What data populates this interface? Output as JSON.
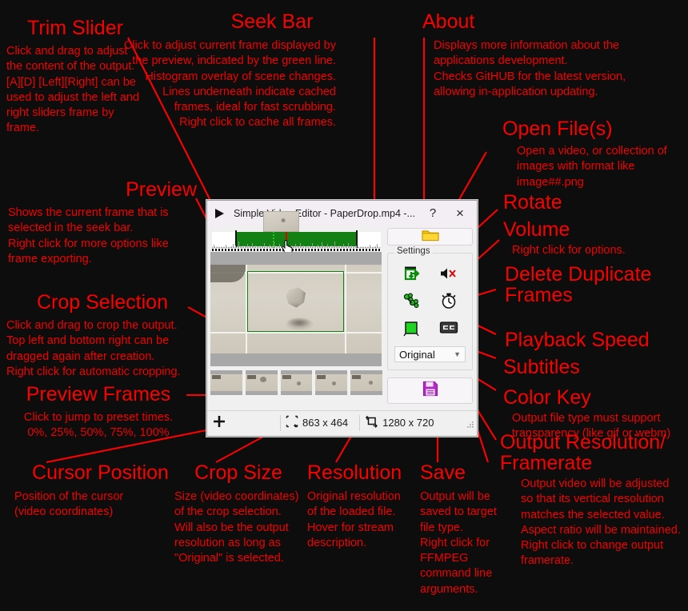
{
  "annotations": [
    {
      "key": "trim_slider",
      "title": "Trim Slider",
      "body": "Click and drag to adjust\nthe content of the output.\n[A][D] [Left][Right] can be\nused to adjust the left and\nright sliders frame by frame."
    },
    {
      "key": "seek_bar",
      "title": "Seek Bar",
      "body": "Click to adjust current frame displayed by\nthe preview, indicated by the green line.\nHistogram overlay of scene changes.\nLines underneath indicate cached\nframes, ideal for fast scrubbing.\nRight click to cache all frames."
    },
    {
      "key": "about",
      "title": "About",
      "body": "Displays more information about the\napplications development.\nChecks GitHUB for the latest version,\nallowing in-application updating."
    },
    {
      "key": "open_files",
      "title": "Open File(s)",
      "body": "Open a video, or collection of\nimages with format like\nimage##.png"
    },
    {
      "key": "rotate",
      "title": "Rotate",
      "body": ""
    },
    {
      "key": "volume",
      "title": "Volume",
      "body": "Right click for options."
    },
    {
      "key": "delete_duplicate_frames",
      "title": "Delete Duplicate Frames",
      "body": ""
    },
    {
      "key": "playback_speed",
      "title": "Playback Speed",
      "body": ""
    },
    {
      "key": "subtitles",
      "title": "Subtitles",
      "body": ""
    },
    {
      "key": "color_key",
      "title": "Color Key",
      "body": "Output file type must support\ntransparency (like gif or webm)"
    },
    {
      "key": "output_resolution",
      "title": "Output Resolution/ Framerate",
      "body": "Output video will be adjusted\nso that its vertical resolution\nmatches the selected value.\nAspect ratio will be maintained.\nRight click to change output\nframerate."
    },
    {
      "key": "preview",
      "title": "Preview",
      "body": "Shows the current frame that is\nselected in the seek bar.\nRight click for more options like\nframe exporting."
    },
    {
      "key": "crop_selection",
      "title": "Crop Selection",
      "body": "Click and drag to crop the output.\nTop left and bottom right can be\ndragged again after creation.\nRight click for automatic cropping."
    },
    {
      "key": "preview_frames",
      "title": "Preview Frames",
      "body": "Click to jump to preset times.\n0%, 25%, 50%, 75%, 100%"
    },
    {
      "key": "cursor_position",
      "title": "Cursor Position",
      "body": "Position of the cursor\n(video coordinates)"
    },
    {
      "key": "crop_size",
      "title": "Crop Size",
      "body": "Size (video coordinates)\nof the crop selection.\nWill also be the output\nresolution as long as\n\"Original\" is selected."
    },
    {
      "key": "resolution",
      "title": "Resolution",
      "body": "Original resolution\nof the loaded file.\nHover for stream\ndescription."
    },
    {
      "key": "save",
      "title": "Save",
      "body": "Output will be\nsaved to target\nfile type.\nRight click for\nFFMPEG\ncommand line\narguments."
    }
  ],
  "annotation_color": "#ff0000",
  "app": {
    "title": "Simple Video Editor - PaperDrop.mp4 -...",
    "icon": "play-triangle-icon",
    "titlebar_buttons": [
      {
        "name": "about",
        "label": "?"
      },
      {
        "name": "close",
        "label": "×"
      }
    ],
    "open_button": {
      "icon": "folder-icon",
      "label": ""
    },
    "settings": {
      "group_label": "Settings",
      "buttons": [
        {
          "name": "rotate",
          "icon": "rotate-icon"
        },
        {
          "name": "volume",
          "icon": "speaker-muted-icon"
        },
        {
          "name": "delete-duplicate-frames",
          "icon": "duplicate-frames-icon"
        },
        {
          "name": "playback-speed",
          "icon": "stopwatch-icon"
        },
        {
          "name": "color-key",
          "icon": "green-square-icon"
        },
        {
          "name": "subtitles",
          "icon": "cc-icon"
        }
      ],
      "output_resolution": {
        "value": "Original",
        "options": [
          "Original"
        ]
      }
    },
    "save_button": {
      "icon": "floppy-save-icon",
      "label": ""
    },
    "statusbar": {
      "cursor_position": {
        "icon": "crosshair-icon",
        "value": ""
      },
      "crop_size": {
        "icon": "crop-icon",
        "value": "863 x 464"
      },
      "resolution": {
        "icon": "resolution-icon",
        "value": "1280 x 720"
      }
    },
    "colors": {
      "trim_region": "#138013",
      "playhead": "#e20000",
      "current_frame_line": "#29c229",
      "crop_outline": "#128012",
      "color_key_swatch": "#22d422",
      "save_icon": "#b429c8",
      "folder_icon": "#ffcc00",
      "window_bg": "#f0f0f0",
      "titlebar_bg": "#f3eef3"
    },
    "preview_frames_count": 5
  }
}
